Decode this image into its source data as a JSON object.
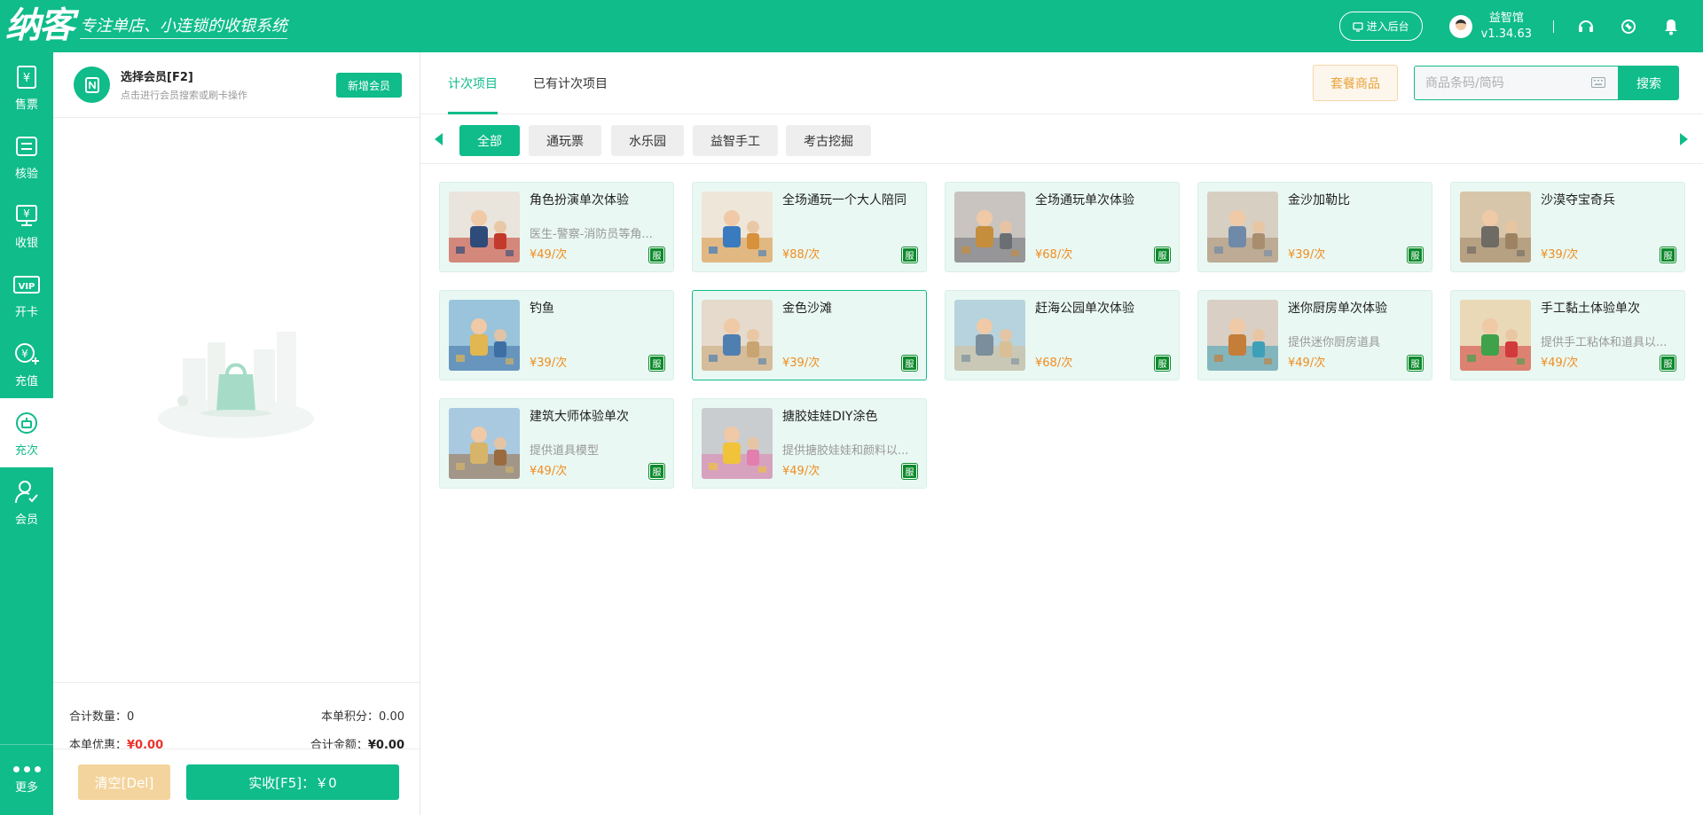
{
  "header": {
    "logo": "纳客",
    "slogan": "专注单店、小连锁的收银系统",
    "backend_button": "进入后台",
    "store_name": "益智馆",
    "version": "v1.34.63",
    "brand_color": "#0fbc8a"
  },
  "sidebar": {
    "items": [
      {
        "label": "售票",
        "icon": "ticket-icon"
      },
      {
        "label": "核验",
        "icon": "verify-icon"
      },
      {
        "label": "收银",
        "icon": "cashier-icon"
      },
      {
        "label": "开卡",
        "icon": "vip-card-icon"
      },
      {
        "label": "充值",
        "icon": "recharge-icon"
      },
      {
        "label": "充次",
        "icon": "recharge-count-icon"
      },
      {
        "label": "会员",
        "icon": "member-icon"
      }
    ],
    "more_label": "更多"
  },
  "member_panel": {
    "title": "选择会员[F2]",
    "hint": "点击进行会员搜索或刷卡操作",
    "add_button": "新增会员"
  },
  "summary": {
    "qty_label": "合计数量：",
    "qty_value": "0",
    "points_label": "本单积分：",
    "points_value": "0.00",
    "discount_label": "本单优惠：",
    "discount_value": "¥0.00",
    "total_label": "合计金额：",
    "total_value": "¥0.00"
  },
  "actions": {
    "clear_button": "清空[Del]",
    "pay_button": "实收[F5]：￥0"
  },
  "tabs": [
    {
      "label": "计次项目",
      "active": true
    },
    {
      "label": "已有计次项目",
      "active": false
    }
  ],
  "toolbar": {
    "package_button": "套餐商品",
    "search_placeholder": "商品条码/简码",
    "search_button": "搜索"
  },
  "categories": [
    {
      "label": "全部",
      "active": true
    },
    {
      "label": "通玩票",
      "active": false
    },
    {
      "label": "水乐园",
      "active": false
    },
    {
      "label": "益智手工",
      "active": false
    },
    {
      "label": "考古挖掘",
      "active": false
    }
  ],
  "products": [
    {
      "name": "角色扮演单次体验",
      "desc": "医生-警察-消防员等角...",
      "price": "¥49/次",
      "badge": "服",
      "colors": [
        "#e9e4dc",
        "#c33a2c",
        "#2f4b7a"
      ]
    },
    {
      "name": "全场通玩一个大人陪同",
      "desc": "",
      "price": "¥88/次",
      "badge": "服",
      "colors": [
        "#efe6da",
        "#d7913a",
        "#3a7bbf"
      ]
    },
    {
      "name": "全场通玩单次体验",
      "desc": "",
      "price": "¥68/次",
      "badge": "服",
      "colors": [
        "#c9c4c0",
        "#6b6f74",
        "#c58e3c"
      ]
    },
    {
      "name": "金沙加勒比",
      "desc": "",
      "price": "¥39/次",
      "badge": "服",
      "colors": [
        "#d8cfc3",
        "#a88e6f",
        "#6f8aa8"
      ]
    },
    {
      "name": "沙漠夺宝奇兵",
      "desc": "",
      "price": "¥39/次",
      "badge": "服",
      "colors": [
        "#d8c6ab",
        "#9d8362",
        "#6e6a64"
      ]
    },
    {
      "name": "钓鱼",
      "desc": "",
      "price": "¥39/次",
      "badge": "服",
      "colors": [
        "#9ac4dc",
        "#3e6fa4",
        "#e2b650"
      ]
    },
    {
      "name": "金色沙滩",
      "desc": "",
      "price": "¥39/次",
      "badge": "服",
      "colors": [
        "#e5dacb",
        "#c8a472",
        "#4f7fb1"
      ]
    },
    {
      "name": "赶海公园单次体验",
      "desc": "",
      "price": "¥68/次",
      "badge": "服",
      "colors": [
        "#b7d3dd",
        "#d9bf95",
        "#7a8e9c"
      ]
    },
    {
      "name": "迷你厨房单次体验",
      "desc": "提供迷你厨房道具",
      "price": "¥49/次",
      "badge": "服",
      "colors": [
        "#d9cfc4",
        "#3da0b8",
        "#c57d3a"
      ]
    },
    {
      "name": "手工黏土体验单次",
      "desc": "提供手工粘体和道具以...",
      "price": "¥49/次",
      "badge": "服",
      "colors": [
        "#ead9b7",
        "#d13b3b",
        "#3fa24b"
      ]
    },
    {
      "name": "建筑大师体验单次",
      "desc": "提供道具模型",
      "price": "¥49/次",
      "badge": "服",
      "colors": [
        "#a8c9e0",
        "#9a6b3e",
        "#d6b46a"
      ]
    },
    {
      "name": "搪胶娃娃DIY涂色",
      "desc": "提供搪胶娃娃和颜料以...",
      "price": "¥49/次",
      "badge": "服",
      "colors": [
        "#c9cdd0",
        "#e27fae",
        "#f0c33a"
      ]
    }
  ],
  "selected_product_index": 6
}
